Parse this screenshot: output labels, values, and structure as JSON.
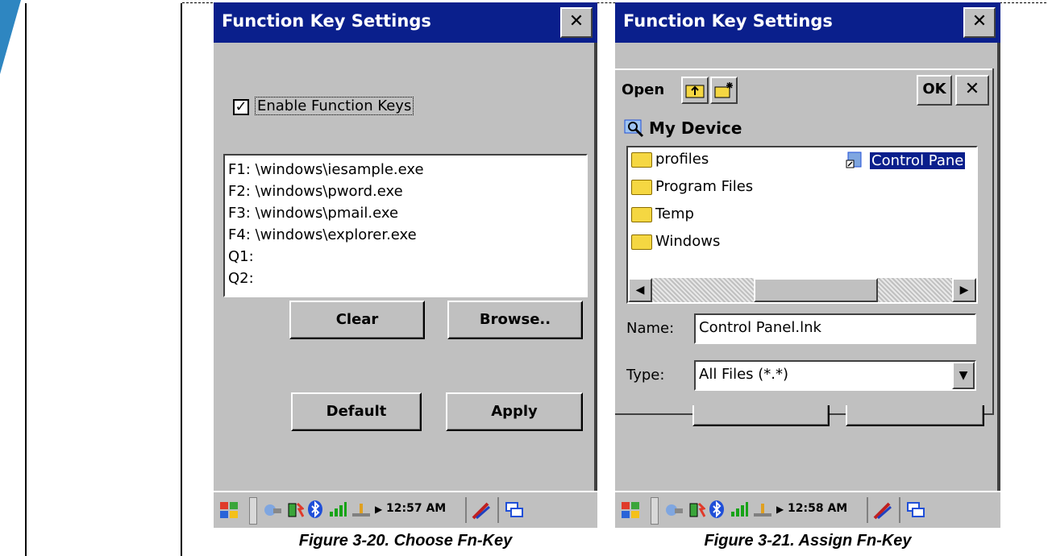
{
  "left_window": {
    "title": "Function Key Settings",
    "close_label": "✕",
    "checkbox_label": "Enable Function Keys",
    "checkbox_checked": true,
    "list_items": [
      "F1: \\windows\\iesample.exe",
      "F2: \\windows\\pword.exe",
      "F3: \\windows\\pmail.exe",
      "F4: \\windows\\explorer.exe",
      "Q1:",
      "Q2:"
    ],
    "clear_label": "Clear",
    "browse_label": "Browse..",
    "default_label": "Default",
    "apply_label": "Apply",
    "time": "12:57 AM"
  },
  "right_window": {
    "title": "Function Key Settings",
    "close_label": "✕",
    "open_label": "Open",
    "ok_label": "OK",
    "cancel_label": "✕",
    "location": "My Device",
    "files": [
      {
        "name": "profiles",
        "icon": "folder-icon"
      },
      {
        "name": "Program Files",
        "icon": "folder-icon"
      },
      {
        "name": "Temp",
        "icon": "folder-icon"
      },
      {
        "name": "Windows",
        "icon": "folder-icon"
      }
    ],
    "selected_file": "Control Pane",
    "name_label": "Name:",
    "name_value": "Control Panel.lnk",
    "type_label": "Type:",
    "type_value": "All Files (*.*)",
    "time": "12:58 AM"
  },
  "captions": {
    "left": "Figure 3-20. Choose Fn-Key",
    "right": "Figure 3-21. Assign Fn-Key"
  },
  "colors": {
    "titlebar": "#0a1f8c",
    "corner_accent": "#2e86c1",
    "selection": "#0a1f8c"
  }
}
